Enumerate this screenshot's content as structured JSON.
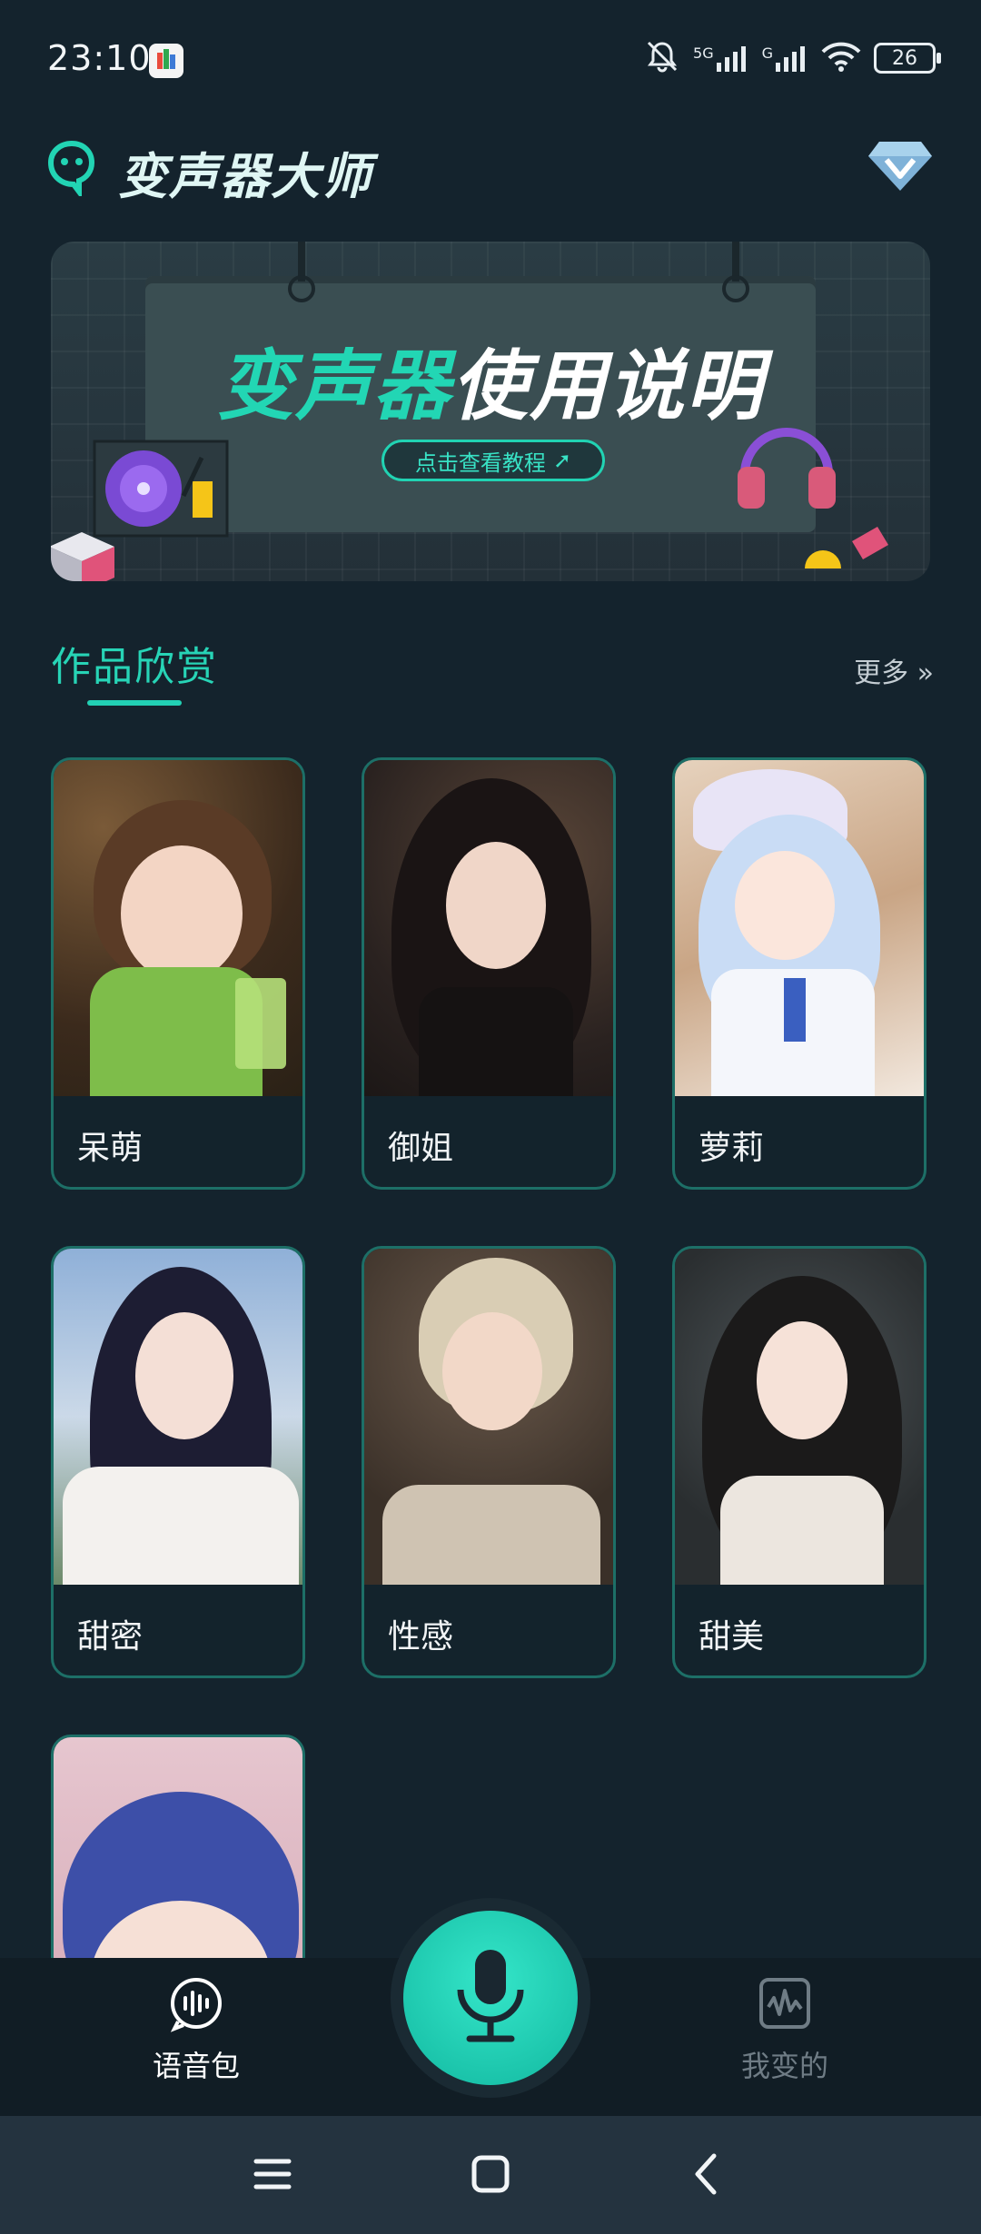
{
  "status_bar": {
    "time": "23:10",
    "battery": "26",
    "network_1": "5G",
    "network_2": "G"
  },
  "header": {
    "app_title": "变声器大师"
  },
  "banner": {
    "title_part1": "变声器",
    "title_part2": "使用说明",
    "button_label": "点击查看教程"
  },
  "section": {
    "title": "作品欣赏",
    "more_label": "更多 »"
  },
  "cards": [
    {
      "label": "呆萌",
      "image": "cute-girl-portrait"
    },
    {
      "label": "御姐",
      "image": "mature-woman-portrait"
    },
    {
      "label": "萝莉",
      "image": "loli-anime-portrait"
    },
    {
      "label": "甜密",
      "image": "sweet-girl-portrait"
    },
    {
      "label": "性感",
      "image": "sexy-woman-portrait"
    },
    {
      "label": "甜美",
      "image": "sweet-beauty-portrait"
    },
    {
      "label": "",
      "image": "blue-hair-anime-portrait"
    }
  ],
  "bottom_nav": {
    "voice_pack": "语音包",
    "my_changes": "我变的"
  },
  "colors": {
    "accent": "#22d4b4",
    "background": "#14232d",
    "card_border": "#1d6f67"
  }
}
